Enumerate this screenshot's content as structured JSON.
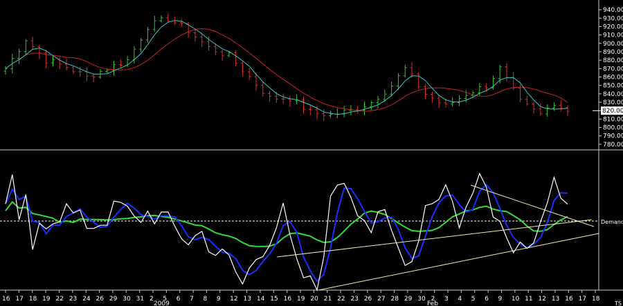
{
  "chart_data": [
    {
      "type": "candlestick",
      "panel": "price",
      "title": "",
      "ylim": [
        775,
        945
      ],
      "yticks": [
        780,
        790,
        800,
        810,
        820,
        830,
        840,
        850,
        860,
        870,
        880,
        890,
        900,
        910,
        920,
        930,
        940
      ],
      "last_value": "820.00",
      "colors": {
        "up": "#2ecc2e",
        "down": "#e03030",
        "ma_fast": "#33cccc",
        "ma_slow": "#cc2222"
      },
      "close_anchors": [
        [
          0,
          870
        ],
        [
          3,
          905
        ],
        [
          6,
          880
        ],
        [
          9,
          872
        ],
        [
          12,
          860
        ],
        [
          15,
          870
        ],
        [
          18,
          880
        ],
        [
          21,
          920
        ],
        [
          24,
          930
        ],
        [
          27,
          915
        ],
        [
          30,
          895
        ],
        [
          33,
          885
        ],
        [
          36,
          860
        ],
        [
          39,
          835
        ],
        [
          42,
          835
        ],
        [
          45,
          818
        ],
        [
          48,
          815
        ],
        [
          51,
          820
        ],
        [
          54,
          830
        ],
        [
          57,
          850
        ],
        [
          59,
          870
        ],
        [
          62,
          840
        ],
        [
          65,
          825
        ],
        [
          68,
          840
        ],
        [
          71,
          850
        ],
        [
          73,
          870
        ],
        [
          76,
          830
        ],
        [
          79,
          815
        ],
        [
          81,
          830
        ],
        [
          83,
          820
        ]
      ]
    },
    {
      "type": "line",
      "panel": "indicator",
      "baseline_label": "Demand",
      "colors": {
        "fast": "#ffffff",
        "medium": "#1a2eff",
        "slow": "#33dd33",
        "trend": "#f0f0b0"
      },
      "value_anchors": [
        [
          0,
          10
        ],
        [
          1,
          45
        ],
        [
          2,
          5
        ],
        [
          3,
          20
        ],
        [
          4,
          -45
        ],
        [
          5,
          0
        ],
        [
          7,
          5
        ],
        [
          9,
          15
        ],
        [
          11,
          0
        ],
        [
          13,
          -5
        ],
        [
          15,
          5
        ],
        [
          17,
          20
        ],
        [
          19,
          0
        ],
        [
          21,
          10
        ],
        [
          23,
          5
        ],
        [
          25,
          -10
        ],
        [
          27,
          -25
        ],
        [
          29,
          -15
        ],
        [
          31,
          -40
        ],
        [
          33,
          -50
        ],
        [
          35,
          -80
        ],
        [
          37,
          -45
        ],
        [
          39,
          -20
        ],
        [
          41,
          10
        ],
        [
          43,
          -60
        ],
        [
          45,
          -80
        ],
        [
          46,
          -85
        ],
        [
          48,
          20
        ],
        [
          49,
          50
        ],
        [
          50,
          55
        ],
        [
          52,
          20
        ],
        [
          54,
          -10
        ],
        [
          56,
          5
        ],
        [
          58,
          -35
        ],
        [
          60,
          -50
        ],
        [
          62,
          20
        ],
        [
          64,
          35
        ],
        [
          65,
          45
        ],
        [
          67,
          0
        ],
        [
          69,
          30
        ],
        [
          70,
          60
        ],
        [
          71,
          55
        ],
        [
          72,
          20
        ],
        [
          74,
          -20
        ],
        [
          76,
          -30
        ],
        [
          78,
          -15
        ],
        [
          80,
          25
        ],
        [
          81,
          50
        ],
        [
          82,
          15
        ],
        [
          83,
          10
        ]
      ]
    }
  ],
  "xaxis": {
    "labels": [
      "16",
      "17",
      "18",
      "19",
      "22",
      "23",
      "24",
      "26",
      "29",
      "30",
      "31",
      "2",
      "5",
      "6",
      "7",
      "8",
      "9",
      "12",
      "13",
      "14",
      "15",
      "16",
      "19",
      "20",
      "21",
      "22",
      "23",
      "26",
      "27",
      "28",
      "29",
      "30",
      "2",
      "3",
      "4",
      "5",
      "6",
      "9",
      "10",
      "11",
      "12",
      "13",
      "16",
      "17",
      "18"
    ],
    "year_label": "2009",
    "month_label": "Feb",
    "corner_label": "TS"
  }
}
